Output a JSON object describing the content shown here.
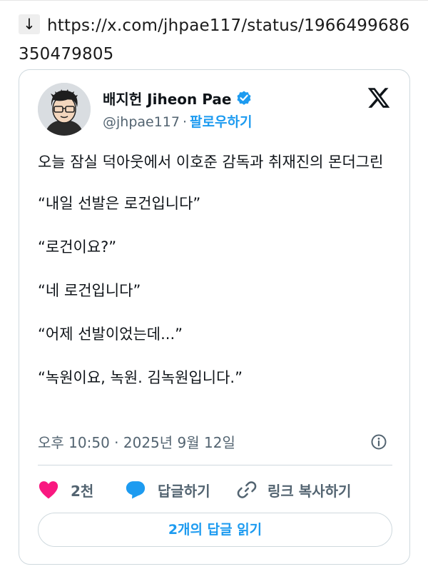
{
  "link_line": {
    "arrow": "↓",
    "url": "https://x.com/jhpae117/status/1966499686350479805"
  },
  "tweet": {
    "author_name": "배지헌 Jiheon Pae",
    "handle": "@jhpae117",
    "separator": "·",
    "follow_label": "팔로우하기",
    "paragraphs": [
      "오늘 잠실 덕아웃에서 이호준 감독과 취재진의 몬더그린",
      "“내일 선발은 로건입니다”",
      "“로건이요?”",
      "“네 로건입니다”",
      "“어제 선발이었는데...”",
      "“녹원이요, 녹원. 김녹원입니다.”"
    ],
    "timestamp": "오후 10:50 · 2025년 9월 12일"
  },
  "actions": {
    "like_count": "2천",
    "reply_label": "답글하기",
    "copy_link_label": "링크 복사하기",
    "read_replies_label": "2개의 답글 읽기"
  },
  "colors": {
    "accent": "#1d9bf0",
    "like": "#f91880",
    "secondary_text": "#536471",
    "border": "#cfd9de"
  },
  "icons": {
    "arrow": "down-arrow-icon",
    "verified": "verified-badge-icon",
    "logo": "x-logo-icon",
    "info": "info-icon",
    "like": "heart-icon",
    "reply": "speech-bubble-icon",
    "copy_link": "link-icon"
  }
}
